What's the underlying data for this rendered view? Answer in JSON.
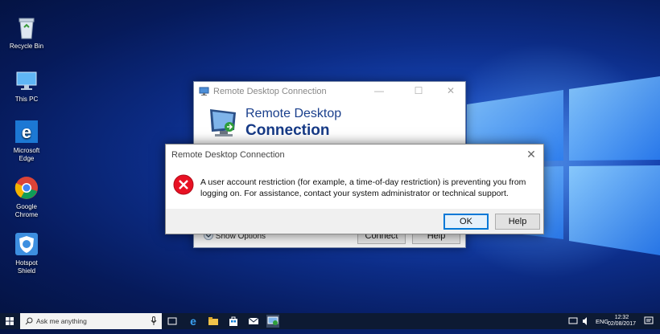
{
  "desktop_icons": [
    {
      "label_lines": [
        "Recycle Bin"
      ],
      "icon": "recycle-bin-icon"
    },
    {
      "label_lines": [
        "This PC"
      ],
      "icon": "this-pc-icon"
    },
    {
      "label_lines": [
        "Microsoft",
        "Edge"
      ],
      "icon": "edge-icon"
    },
    {
      "label_lines": [
        "Google",
        "Chrome"
      ],
      "icon": "chrome-icon"
    },
    {
      "label_lines": [
        "Hotspot",
        "Shield"
      ],
      "icon": "hotspot-shield-icon"
    }
  ],
  "rdc_window": {
    "title": "Remote Desktop Connection",
    "banner_line1": "Remote Desktop",
    "banner_line2": "Connection",
    "show_options": "Show Options",
    "connect_label": "Connect",
    "help_label": "Help"
  },
  "error_dialog": {
    "title": "Remote Desktop Connection",
    "message": "A user account restriction (for example, a time-of-day restriction) is preventing you from logging on. For assistance, contact your system administrator or technical support.",
    "ok_label": "OK",
    "help_label": "Help",
    "icon": "error-icon"
  },
  "taskbar": {
    "search_placeholder": "Ask me anything",
    "language": "ENG",
    "time": "12:32",
    "date": "02/08/2017"
  },
  "colors": {
    "accent": "#0078d7",
    "error_red": "#e81123",
    "taskbar": "#0d1a33"
  }
}
